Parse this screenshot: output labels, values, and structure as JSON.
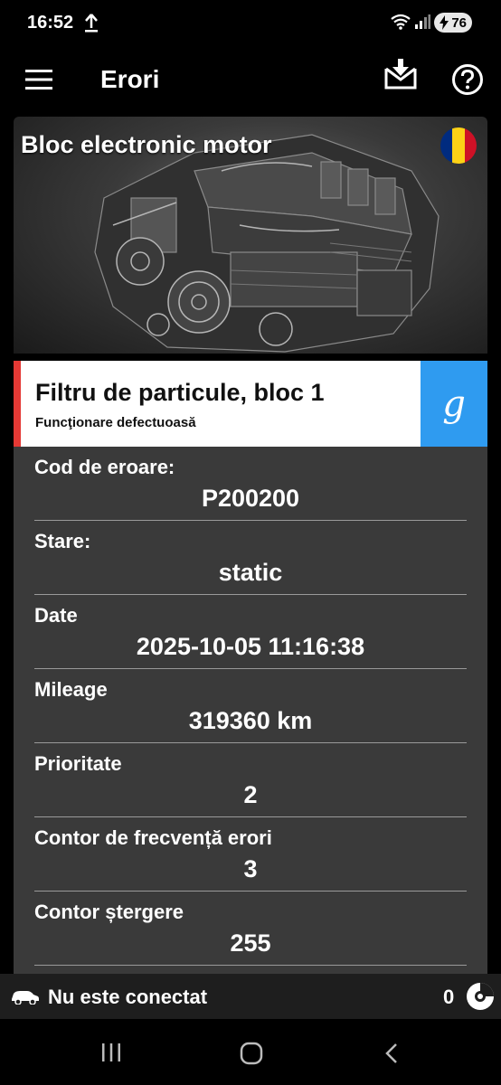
{
  "status_bar": {
    "time": "16:52",
    "battery": "76"
  },
  "app_bar": {
    "title": "Erori",
    "icons": [
      "menu-icon",
      "download-icon",
      "help-icon"
    ]
  },
  "engine_card": {
    "title": "Bloc electronic motor",
    "flag_colors": [
      "#002B7F",
      "#FCD116",
      "#CE1126"
    ]
  },
  "error": {
    "title": "Filtru de particule, bloc 1",
    "subtitle": "Funcţionare defectuoasă",
    "search_icon_letter": "g",
    "accent_color": "#e53935",
    "button_color": "#2f9bf0"
  },
  "details": [
    {
      "label": "Cod de eroare:",
      "value": "P200200"
    },
    {
      "label": "Stare:",
      "value": "static"
    },
    {
      "label": "Date",
      "value": "2025-10-05 11:16:38"
    },
    {
      "label": "Mileage",
      "value": "319360 km"
    },
    {
      "label": "Prioritate",
      "value": "2"
    },
    {
      "label": "Contor de frecvență erori",
      "value": "3"
    },
    {
      "label": "Contor ștergere",
      "value": "255"
    }
  ],
  "connection": {
    "status": "Nu este conectat",
    "count": "0"
  }
}
